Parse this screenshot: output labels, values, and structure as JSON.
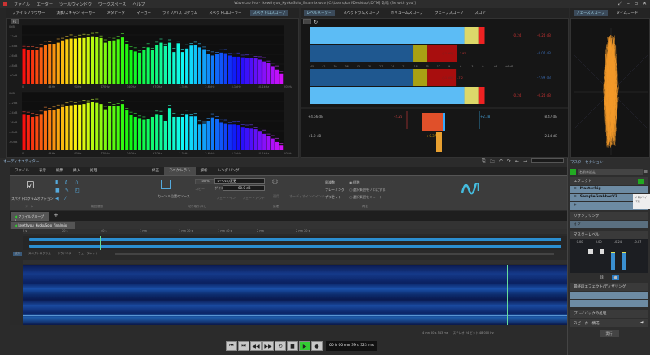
{
  "app": {
    "title": "WaveLab Pro - [kewthyou_KyokuSolo_finalmix.wav (C:\\Users\\kari\\Desktop\\[DTM] 歌唱 (Be with you)]"
  },
  "menu": [
    "ファイル",
    "エーター",
    "ツールウィンドウ",
    "ワークスペース",
    "ヘルプ"
  ],
  "top_tabs_left": [
    "ファイルブラウザー",
    "演奏/スキャン マーカー",
    "メタデータ",
    "マーカー",
    "ライブ/バス ログラム",
    "スペクトロローラー",
    "スペクトロスコープ"
  ],
  "top_tabs_mid": [
    "レベルメーター",
    "スペクトラムスコープ",
    "ボリュームスコープ",
    "ウェーブスコープ",
    "スコア"
  ],
  "top_tabs_right": [
    "フェーズスコープ",
    "タイムコード"
  ],
  "spectrum": {
    "button": "FG",
    "x_ticks": [
      "0",
      "44Hz",
      "90Hz",
      "170Hz",
      "340Hz",
      "670Hz",
      "1.3kHz",
      "2.6kHz",
      "5.1kHz",
      "10.1kHz",
      "20kHz"
    ],
    "y_ticks": [
      "0dB",
      "-12dB",
      "-24dB",
      "-36dB",
      "-48dB",
      "-60dB"
    ],
    "channels": [
      {
        "name": "L",
        "levels": [
          60,
          58,
          57,
          58,
          62,
          66,
          68,
          68,
          70,
          74,
          76,
          77,
          77,
          78,
          78,
          80,
          81,
          80,
          78,
          70,
          73,
          74,
          76,
          79,
          68,
          58,
          55,
          53,
          57,
          62,
          57,
          66,
          70,
          64,
          70,
          54,
          69,
          54,
          60,
          65,
          66,
          62,
          59,
          51,
          48,
          50,
          53,
          52,
          48,
          46,
          46,
          45,
          44,
          44,
          43,
          41,
          38,
          35,
          30,
          24,
          17
        ]
      },
      {
        "name": "R",
        "levels": [
          62,
          60,
          57,
          58,
          62,
          67,
          68,
          69,
          71,
          74,
          76,
          77,
          78,
          78,
          79,
          81,
          82,
          81,
          79,
          70,
          75,
          75,
          75,
          79,
          68,
          60,
          57,
          55,
          52,
          54,
          57,
          62,
          60,
          50,
          72,
          57,
          57,
          57,
          62,
          58,
          58,
          44,
          45,
          50,
          56,
          54,
          48,
          45,
          44,
          44,
          43,
          40,
          38,
          37,
          36,
          33,
          28,
          24,
          20,
          14,
          8
        ]
      }
    ]
  },
  "level_meter": {
    "scale": [
      "-45",
      "-42",
      "-39",
      "-36",
      "-33",
      "-30",
      "-27",
      "-24",
      "-21",
      "-18",
      "-15",
      "-12",
      "-9",
      "-6",
      "-3",
      "0",
      "+3",
      "+6 dB"
    ],
    "channels": [
      {
        "name": "L",
        "peak": -2.0,
        "peak_label": "-0.24",
        "peak_db": "-0.24 dB",
        "rms": -8.0,
        "rms_label": "(11 dB)",
        "rms_peak": "-7.92",
        "rms_db": "-8.07 dB"
      },
      {
        "name": "R",
        "peak": -2.0,
        "peak_label": "-0.24",
        "peak_db": "-0.24 dB",
        "rms": -8.3,
        "rms_label": "(11 dB)",
        "rms_peak": "-7.2",
        "rms_db": "-7.99 dB"
      }
    ],
    "balance": {
      "left": "+4.66 dB",
      "min": "-2.26",
      "max": "+2.38",
      "right": "-8.47 dB"
    },
    "balance2": {
      "left": "+1.2 dB",
      "value": "+0.37",
      "right": "-2.14 dB"
    }
  },
  "audio_editor": {
    "title": "オーディオエディター",
    "ribbon_tabs": [
      "ファイル",
      "表示",
      "編集",
      "挿入",
      "処理"
    ],
    "ribbon_tabs_right": [
      "修正",
      "スペクトラム",
      "解析",
      "レンダリング"
    ],
    "options_label": "スペクトログラムオプション",
    "cursor_source": "カーソル位置のソース",
    "zoom_value": "100 %",
    "copy": "コピー",
    "level_change": "レベルの変更",
    "gain_label": "ゲイン",
    "gain_value": "-60.0 dB",
    "fade_in": "フェードイン",
    "fade_out": "フェードアウト",
    "apply": "適用",
    "crossfade": "オーディオインペインティング",
    "opts": [
      "周波数",
      "フレーミング",
      "プリセット"
    ],
    "radio": [
      "標準",
      "選択範囲をソロにする",
      "選択範囲をミュート"
    ],
    "groups": [
      "ツール",
      "範囲/選択",
      "切り取り/コピー",
      "処理",
      "再生"
    ],
    "file_group": "ファイルグループ 1",
    "file_tab": "kewthyou_KyokuSolo_finalmix",
    "overview_ticks": [
      "0 s",
      "20 s",
      "40 s",
      "1 mn",
      "1 mn 20 s",
      "1 mn 40 s",
      "2 mn",
      "2 mn 20 s"
    ],
    "view_tabs": [
      "波形",
      "スペクトログラム",
      "ラウドネス",
      "ウェーブレット"
    ],
    "status": "4 mn 20 s 543 ms",
    "status2": "ステレオ 24 ビット 48 000 Hz",
    "time": "00 h 00 mn 39 s 323 ms"
  },
  "master": {
    "title": "マスターセクション",
    "preset": "名前未設定",
    "effects_label": "エフェクト",
    "plugins": [
      "MasterRig",
      "SampleGrabberV3"
    ],
    "tooltip": "ソロ/バイパス",
    "resampling": "リサンプリング",
    "resampling_value": "オフ",
    "master_level": "マスターレベル",
    "level_values": [
      "0.00",
      "0.00",
      "-0.24",
      "-0.07"
    ],
    "dither": "最終段エフェクト/ディザリング",
    "playback": "プレイバックの処理",
    "speaker": "スピーカー構成",
    "render": "実行",
    "meter_fill": [
      0.72,
      0.74
    ]
  }
}
